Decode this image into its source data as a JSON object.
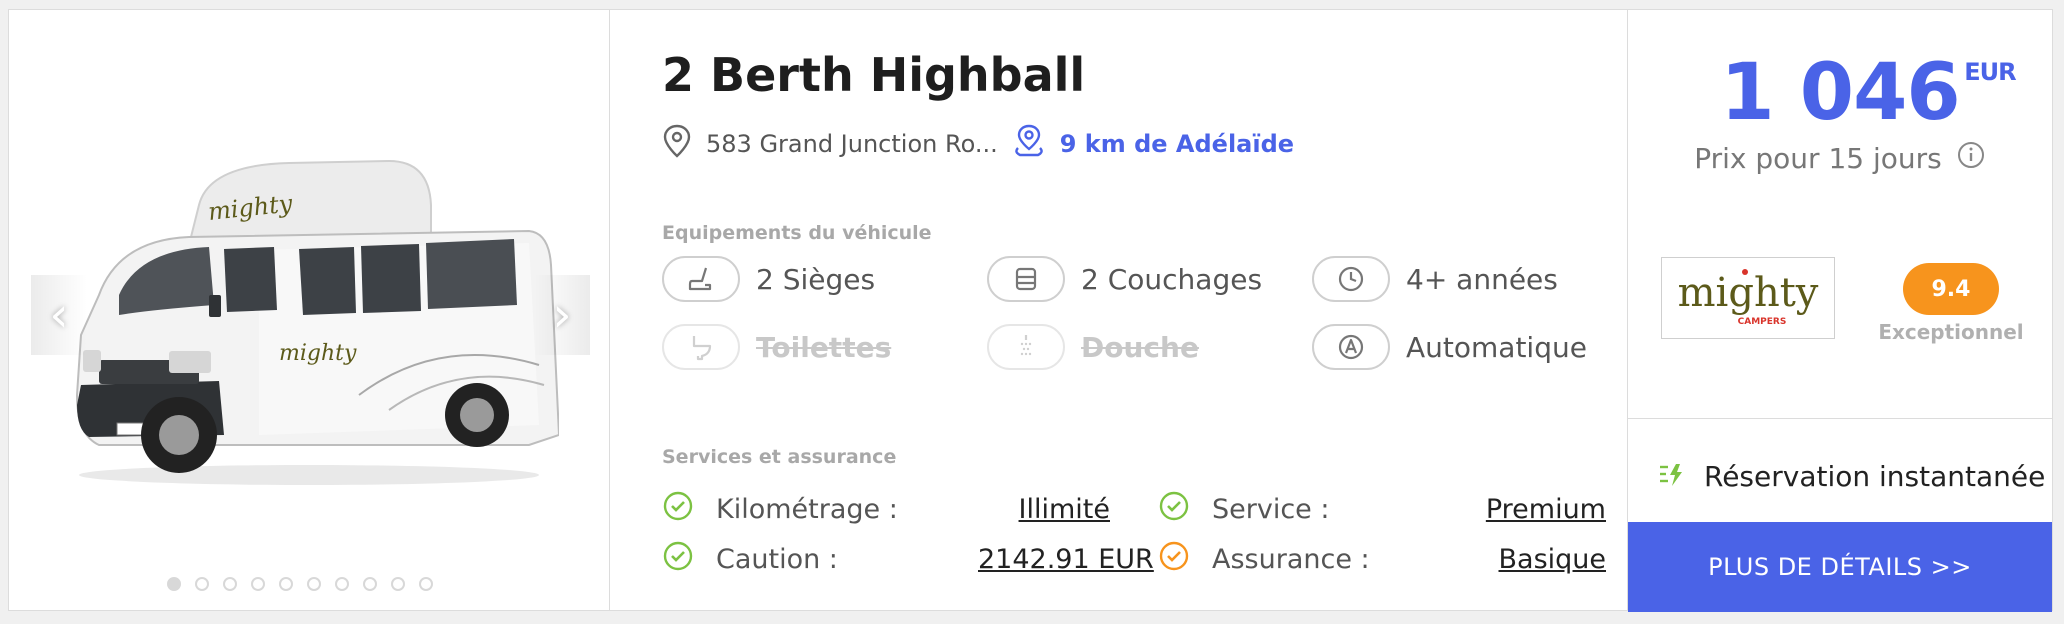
{
  "listing": {
    "title": "2 Berth Highball",
    "address": "583 Grand Junction Ro...",
    "distance": "9 km de Adélaïde"
  },
  "gallery": {
    "prev_label": "‹",
    "next_label": "›",
    "image_count": 10,
    "active_index": 0,
    "van_branding": "mighty"
  },
  "equipment": {
    "section_title": "Equipements du véhicule",
    "items": [
      {
        "icon": "seat-icon",
        "label": "2 Sièges",
        "available": true
      },
      {
        "icon": "bed-icon",
        "label": "2 Couchages",
        "available": true
      },
      {
        "icon": "clock-icon",
        "label": "4+ années",
        "available": true
      },
      {
        "icon": "toilet-icon",
        "label": "Toilettes",
        "available": false
      },
      {
        "icon": "shower-icon",
        "label": "Douche",
        "available": false
      },
      {
        "icon": "automatic-transmission-icon",
        "label": "Automatique",
        "available": true
      }
    ]
  },
  "services": {
    "section_title": "Services et assurance",
    "items": [
      {
        "label": "Kilométrage :",
        "value": "Illimité",
        "status": "green"
      },
      {
        "label": "Service :",
        "value": "Premium",
        "status": "green"
      },
      {
        "label": "Caution :",
        "value": "2142.91 EUR",
        "status": "green"
      },
      {
        "label": "Assurance :",
        "value": "Basique",
        "status": "orange"
      }
    ]
  },
  "pricing": {
    "amount": "1 046",
    "currency": "EUR",
    "subtitle": "Prix pour 15 jours"
  },
  "provider": {
    "logo_main": "mighty",
    "logo_sub": "CAMPERS",
    "rating": "9.4",
    "rating_label": "Exceptionnel"
  },
  "booking": {
    "instant_label": "Réservation instantanée",
    "details_button": "PLUS DE DÉTAILS >>"
  },
  "colors": {
    "accent": "#4a63e7",
    "rating": "#f7941d",
    "check_green": "#7cc242",
    "check_orange": "#f7941d",
    "logo_red": "#d9342b",
    "logo_olive": "#5c5a1a"
  }
}
